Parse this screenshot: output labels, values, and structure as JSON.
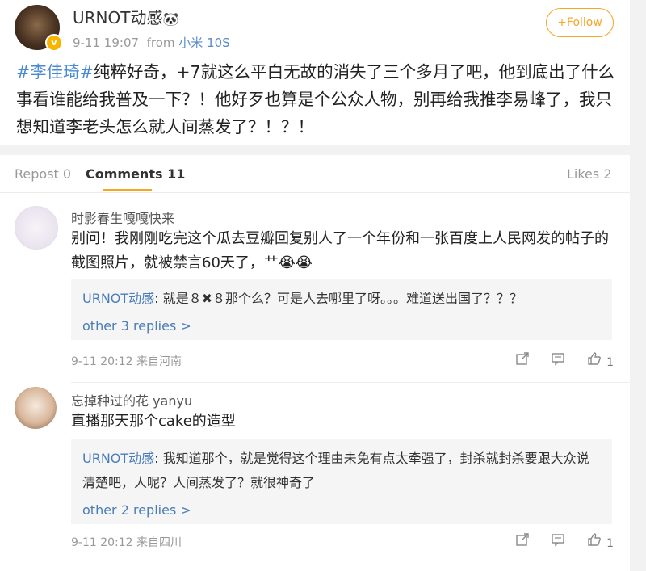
{
  "post": {
    "username": "URNOT动感",
    "username_emoji": "🐼",
    "timestamp": "9-11 19:07",
    "from_label": "from",
    "source": "小米 10S",
    "follow_label": "+Follow",
    "hashtag": "#李佳琦#",
    "text": "纯粹好奇，+7就这么平白无故的消失了三个多月了吧，他到底出了什么事看谁能给我普及一下？！他好歹也算是个公众人物，别再给我推李易峰了，我只想知道李老头怎么就人间蒸发了？！？！"
  },
  "tabs": {
    "repost": "Repost 0",
    "comments": "Comments 11",
    "likes": "Likes 2"
  },
  "comments": [
    {
      "name": "时影春生嘎嘎快来",
      "text": "别问！我刚刚吃完这个瓜去豆瓣回复别人了一个年份和一张百度上人民网发的帖子的截图照片，就被禁言60天了，艹😭😭",
      "reply_name": "URNOT动感",
      "reply_text": ": 就是８✖８那个么？可是人去哪里了呀。。。难道送出国了？？？",
      "more": "other 3 replies >",
      "time_loc": "9-11 20:12 来自河南",
      "likes": "1"
    },
    {
      "name": "忘掉种过的花 yanyu",
      "text": "直播那天那个cake的造型",
      "reply_name": "URNOT动感",
      "reply_text": ": 我知道那个，就是觉得这个理由未免有点太牵强了，封杀就封杀要跟大众说清楚吧，人呢？人间蒸发了？就很神奇了",
      "more": "other 2 replies >",
      "time_loc": "9-11 20:12 来自四川",
      "likes": "1"
    }
  ],
  "icons": {
    "share": "share-icon",
    "comment": "comment-icon",
    "like": "thumbs-up-icon",
    "verified": "verified-badge-icon"
  },
  "colors": {
    "accent": "#f5a623",
    "link": "#4a7db8",
    "hashtag": "#4a8ad4"
  }
}
